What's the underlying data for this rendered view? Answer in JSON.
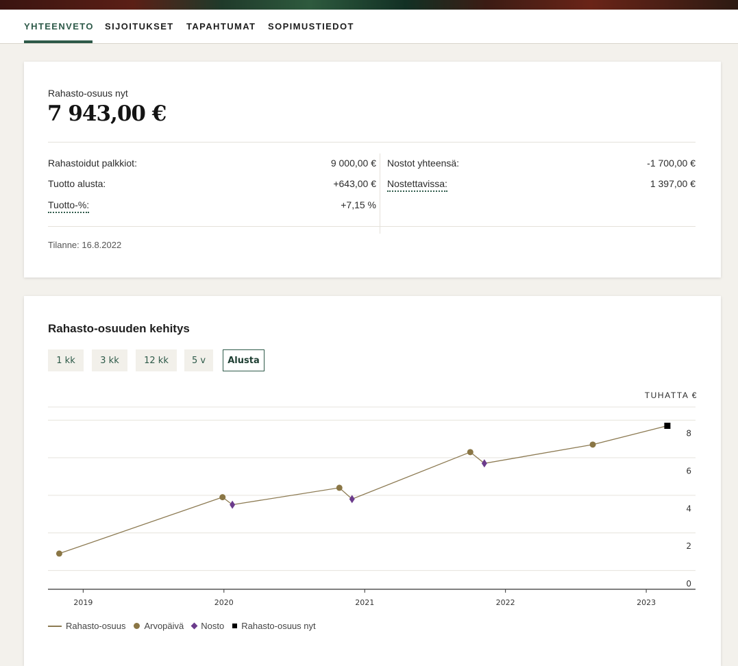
{
  "tabs": [
    "YHTEENVETO",
    "SIJOITUKSET",
    "TAPAHTUMAT",
    "SOPIMUSTIEDOT"
  ],
  "summary": {
    "current_label": "Rahasto-osuus nyt",
    "current_value": "7 943,00 €",
    "left_rows": [
      {
        "label": "Rahastoidut palkkiot:",
        "value": "9 000,00 €"
      },
      {
        "label": "Tuotto alusta:",
        "value": "+643,00 €"
      },
      {
        "label": "Tuotto-%:",
        "value": "+7,15 %"
      }
    ],
    "right_rows": [
      {
        "label": "Nostot yhteensä:",
        "value": "-1 700,00 €"
      },
      {
        "label": "Nostettavissa:",
        "value": "1 397,00 €"
      }
    ],
    "status": "Tilanne: 16.8.2022"
  },
  "chart_section": {
    "title": "Rahasto-osuuden kehitys",
    "ranges": [
      "1 kk",
      "3 kk",
      "12 kk",
      "5 v",
      "Alusta"
    ],
    "selected_range": "Alusta",
    "unit_label": "TUHATTA €"
  },
  "legend": {
    "line": "Rahasto-osuus",
    "dot": "Arvopäivä",
    "diamond": "Nosto",
    "square": "Rahasto-osuus nyt"
  },
  "colors": {
    "accent": "#2e5a49",
    "line": "#8c7a52",
    "valuation_dot": "#8a7645",
    "withdrawal": "#6b3b8c",
    "current": "#000000"
  },
  "chart_data": {
    "type": "line",
    "xlabel": "",
    "ylabel": "",
    "x_ticks": [
      "2019",
      "2020",
      "2021",
      "2022",
      "2023"
    ],
    "y_ticks": [
      "0",
      "2",
      "4",
      "6",
      "8"
    ],
    "xlim": [
      2018.75,
      2023.35
    ],
    "ylim": [
      0,
      9.7
    ],
    "grid": true,
    "legend_position": "bottom-left",
    "series": [
      {
        "name": "Rahasto-osuus",
        "x": [
          2018.83,
          2019.99,
          2020.06,
          2020.82,
          2020.91,
          2021.75,
          2021.85,
          2022.62,
          2023.15
        ],
        "y": [
          1.9,
          4.9,
          4.5,
          5.4,
          4.8,
          7.3,
          6.7,
          7.7,
          8.7
        ]
      }
    ],
    "markers": {
      "valuation": {
        "x": [
          2018.83,
          2019.99,
          2020.82,
          2021.75,
          2022.62
        ],
        "y": [
          1.9,
          4.9,
          5.4,
          7.3,
          7.7
        ]
      },
      "withdrawal": {
        "x": [
          2020.06,
          2020.91,
          2021.85
        ],
        "y": [
          4.5,
          4.8,
          6.7
        ]
      },
      "current": {
        "x": [
          2023.15
        ],
        "y": [
          8.7
        ]
      }
    }
  }
}
